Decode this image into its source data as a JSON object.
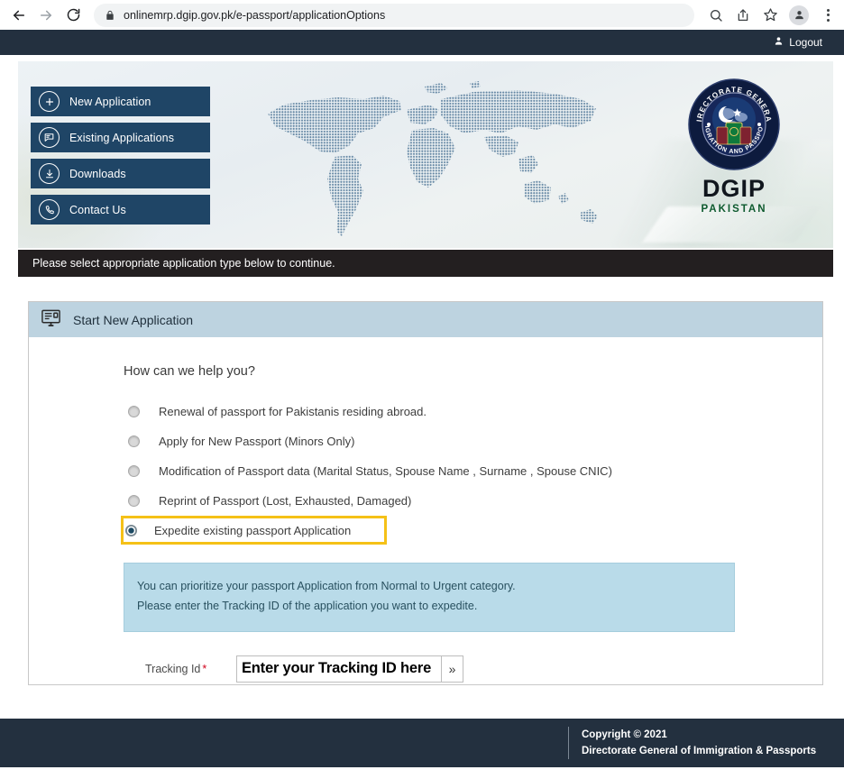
{
  "browser": {
    "url": "onlinemrp.dgip.gov.pk/e-passport/applicationOptions",
    "back_icon": "back-arrow-icon",
    "forward_icon": "forward-arrow-icon",
    "reload_icon": "reload-icon",
    "lock_icon": "lock-icon",
    "search_icon": "search-icon",
    "share_icon": "share-icon",
    "bookmark_icon": "star-icon",
    "profile_icon": "profile-avatar-icon",
    "menu_icon": "kebab-menu-icon"
  },
  "topbar": {
    "logout_label": "Logout",
    "logout_icon": "person-icon"
  },
  "banner": {
    "nav": [
      {
        "label": "New Application",
        "icon": "plus-circle-icon"
      },
      {
        "label": "Existing Applications",
        "icon": "speech-bubble-question-icon"
      },
      {
        "label": "Downloads",
        "icon": "download-arrow-icon"
      },
      {
        "label": "Contact Us",
        "icon": "phone-icon"
      }
    ],
    "logo": {
      "seal_top_text": "DIRECTORATE GENERAL",
      "seal_bottom_text": "IMMIGRATION AND PASSPORTS",
      "title": "DGIP",
      "subtitle": "PAKISTAN"
    }
  },
  "instruction": {
    "text": "Please select appropriate application type below to continue."
  },
  "card": {
    "header_icon": "monitor-document-icon",
    "header_title": "Start New Application",
    "question": "How can we help you?",
    "options": [
      {
        "label": "Renewal of passport for Pakistanis residing abroad.",
        "selected": false
      },
      {
        "label": "Apply for New Passport (Minors Only)",
        "selected": false
      },
      {
        "label": "Modification of Passport data (Marital Status, Spouse Name , Surname , Spouse CNIC)",
        "selected": false
      },
      {
        "label": "Reprint of Passport (Lost, Exhausted, Damaged)",
        "selected": false
      },
      {
        "label": "Expedite existing passport Application",
        "selected": true
      }
    ],
    "info": {
      "line1": "You can prioritize your passport Application from Normal to Urgent category.",
      "line2": "Please enter the Tracking ID of the application you want to expedite."
    },
    "tracking": {
      "label": "Tracking Id",
      "required_mark": "*",
      "value": "Enter your Tracking ID here",
      "placeholder": "Enter your Tracking ID here",
      "go_label": "»"
    }
  },
  "footer": {
    "copyright": "Copyright © 2021",
    "org": "Directorate General of Immigration & Passports"
  },
  "colors": {
    "nav_button": "#1f4566",
    "topbar": "#23303f",
    "card_header": "#bdd3e0",
    "info_box": "#b9dbe9",
    "highlight": "#f5c117",
    "required": "#d0021b"
  }
}
